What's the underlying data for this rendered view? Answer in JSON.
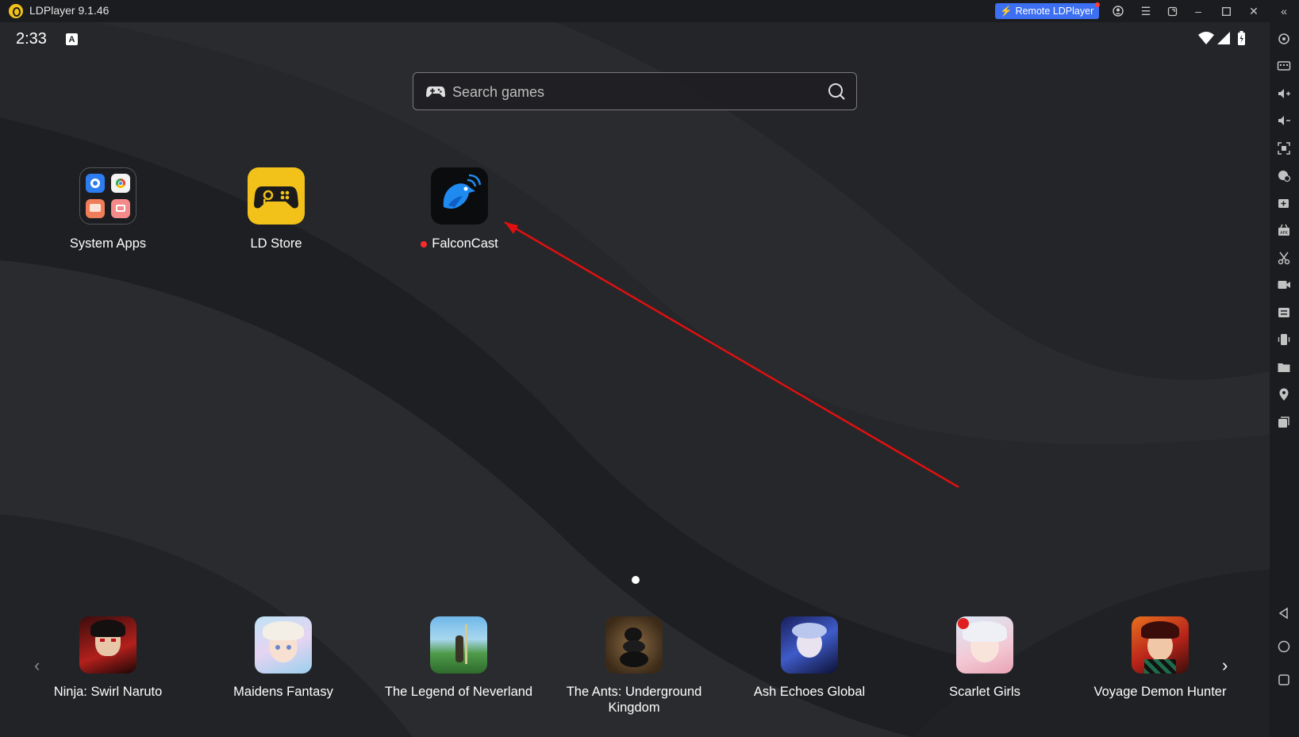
{
  "window": {
    "title": "LDPlayer 9.1.46",
    "remote_label": "Remote LDPlayer"
  },
  "status_bar": {
    "time": "2:33",
    "badge": "A"
  },
  "search": {
    "placeholder": "Search games"
  },
  "apps": [
    {
      "label": "System Apps",
      "icon": "folder-icon"
    },
    {
      "label": "LD Store",
      "icon": "gamepad-icon"
    },
    {
      "label": "FalconCast",
      "icon": "falcon-icon",
      "new": true
    }
  ],
  "page_indicator": {
    "current": 1,
    "total": 1
  },
  "dock_games": [
    {
      "label": "Ninja: Swirl Naruto"
    },
    {
      "label": "Maidens Fantasy"
    },
    {
      "label": "The Legend of Neverland"
    },
    {
      "label": "The Ants: Underground Kingdom"
    },
    {
      "label": "Ash Echoes Global"
    },
    {
      "label": "Scarlet Girls"
    },
    {
      "label": "Voyage Demon Hunter"
    }
  ],
  "colors": {
    "accent_yellow": "#f2c21b",
    "remote_blue": "#3d6ff2",
    "annotation_red": "#e01010"
  }
}
